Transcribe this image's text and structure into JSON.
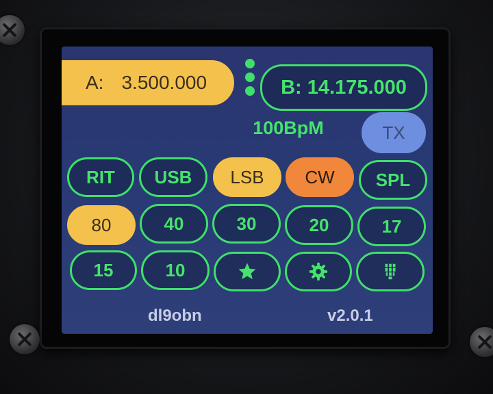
{
  "vfo_a": {
    "prefix": "A:",
    "frequency": "3.500.000"
  },
  "vfo_b": {
    "label": "B: 14.175.000"
  },
  "keyer_speed": "100BpM",
  "tx_label": "TX",
  "mode_row": [
    {
      "label": "RIT",
      "state": "off"
    },
    {
      "label": "USB",
      "state": "off"
    },
    {
      "label": "LSB",
      "state": "active"
    },
    {
      "label": "CW",
      "state": "selected"
    },
    {
      "label": "SPL",
      "state": "off"
    }
  ],
  "band_row_1": [
    {
      "label": "80",
      "state": "active"
    },
    {
      "label": "40",
      "state": "off"
    },
    {
      "label": "30",
      "state": "off"
    },
    {
      "label": "20",
      "state": "off"
    },
    {
      "label": "17",
      "state": "off"
    }
  ],
  "band_row_2": [
    {
      "label": "15",
      "state": "off"
    },
    {
      "label": "10",
      "state": "off"
    }
  ],
  "icon_buttons": [
    "star-icon",
    "gear-icon",
    "memory-chip-icon"
  ],
  "footer": {
    "callsign": "dl9obn",
    "version": "v2.0.1"
  },
  "colors": {
    "green": "#3fe06a",
    "amber": "#f3c14c",
    "orange": "#f0873a",
    "tx_blue": "#6e8fe0",
    "screen_bg": "#2b3570"
  }
}
